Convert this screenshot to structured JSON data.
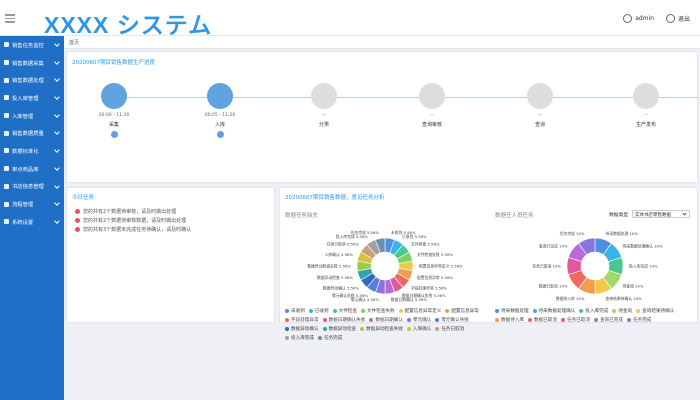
{
  "header": {
    "brand": "XXXX システム",
    "user_name": "admin",
    "logout": "退出"
  },
  "sidebar": {
    "items": [
      {
        "label": "销售任务监控",
        "icon": "monitor-icon"
      },
      {
        "label": "销售数据采集",
        "icon": "database-icon"
      },
      {
        "label": "销售数据处理",
        "icon": "process-icon"
      },
      {
        "label": "投入库管理",
        "icon": "warehouse-icon"
      },
      {
        "label": "入库管理",
        "icon": "inbox-icon"
      },
      {
        "label": "销售数据质量",
        "icon": "quality-icon"
      },
      {
        "label": "数据标准化",
        "icon": "standard-icon"
      },
      {
        "label": "审点商品库",
        "icon": "goods-icon"
      },
      {
        "label": "书店信息管理",
        "icon": "store-icon"
      },
      {
        "label": "流程管理",
        "icon": "flow-icon"
      },
      {
        "label": "系统设置",
        "icon": "settings-icon"
      }
    ]
  },
  "breadcrumb": "首页",
  "progress": {
    "title": "20200607期目销售数据生产进度",
    "steps": [
      {
        "label": "采集",
        "time": "00:00 - 11:26",
        "done": true,
        "icon": "folder-icon"
      },
      {
        "label": "入库",
        "time": "00:05 - 11:26",
        "done": true,
        "icon": "download-icon"
      },
      {
        "label": "分类",
        "time": "--",
        "done": false,
        "icon": "tag-icon"
      },
      {
        "label": "查询审核",
        "time": "--",
        "done": false,
        "icon": "compass-icon"
      },
      {
        "label": "查询",
        "time": "--",
        "done": false,
        "icon": "trophy-icon"
      },
      {
        "label": "生产发布",
        "time": "--",
        "done": false,
        "icon": "share-icon"
      }
    ]
  },
  "tasks": {
    "title": "今日任务",
    "items": [
      "您的共有2个数据待审核，请及时做出处理",
      "您的共有2个数据待审核数据，请及时做出处理",
      "您的共有3个数据未完成任务待确认，请及时确认"
    ]
  },
  "analysis": {
    "title": "20200607期目销售数据，意见任务分析",
    "left_chart_title": "数据任务缺失",
    "right_chart_title": "数据任人员任务",
    "type_label": "数据类型",
    "type_value": "实体书店零售数据"
  },
  "chart_data": [
    {
      "type": "pie",
      "title": "数据任务缺失",
      "slices": [
        {
          "name": "未收到",
          "value": 5.56,
          "color": "#4e8fe0"
        },
        {
          "name": "已收到",
          "value": 5.56,
          "color": "#38b4e8"
        },
        {
          "name": "文件检查",
          "value": 5.56,
          "color": "#49c98e"
        },
        {
          "name": "文件检查失败",
          "value": 5.56,
          "color": "#7ad36a"
        },
        {
          "name": "配置信息异常定义",
          "value": 5.56,
          "color": "#f0c94b"
        },
        {
          "name": "配置信息异常",
          "value": 5.56,
          "color": "#f29d4b"
        },
        {
          "name": "字段处理异常",
          "value": 5.56,
          "color": "#ee6a5f"
        },
        {
          "name": "数据日期确认失败",
          "value": 5.56,
          "color": "#e0589e"
        },
        {
          "name": "数据日期确认",
          "value": 5.56,
          "color": "#b86ad6"
        },
        {
          "name": "零元确认",
          "value": 5.56,
          "color": "#8a74de"
        },
        {
          "name": "零元确认失败",
          "value": 5.56,
          "color": "#5b7ce0"
        },
        {
          "name": "数据异动确认",
          "value": 5.56,
          "color": "#2f6bc0"
        },
        {
          "name": "数据异动检查",
          "value": 5.56,
          "color": "#2fa6a8"
        },
        {
          "name": "数据异动检查失败",
          "value": 5.56,
          "color": "#9acb47"
        },
        {
          "name": "入库确认",
          "value": 5.56,
          "color": "#d8c23c"
        },
        {
          "name": "任务已取消",
          "value": 5.56,
          "color": "#c8a07a"
        },
        {
          "name": "投入库完成",
          "value": 5.56,
          "color": "#a0a0a0"
        },
        {
          "name": "任务完成",
          "value": 5.56,
          "color": "#6d8fb0"
        }
      ]
    },
    {
      "type": "pie",
      "title": "数据任人员任务",
      "slices": [
        {
          "name": "待采数据处理",
          "value": 10,
          "color": "#4e8fe0"
        },
        {
          "name": "待采数据处理确认",
          "value": 10,
          "color": "#38b4e8"
        },
        {
          "name": "投入库完成",
          "value": 10,
          "color": "#49c98e"
        },
        {
          "name": "待查询",
          "value": 10,
          "color": "#a5d86a"
        },
        {
          "name": "查询结果待确认",
          "value": 10,
          "color": "#f0c94b"
        },
        {
          "name": "数据待入库",
          "value": 10,
          "color": "#f29d4b"
        },
        {
          "name": "数据已取消",
          "value": 10,
          "color": "#ee6a5f"
        },
        {
          "name": "任务已取消",
          "value": 10,
          "color": "#e0589e"
        },
        {
          "name": "查询已完成",
          "value": 10,
          "color": "#b86ad6"
        },
        {
          "name": "任务完成",
          "value": 10,
          "color": "#8a74de"
        }
      ]
    }
  ]
}
